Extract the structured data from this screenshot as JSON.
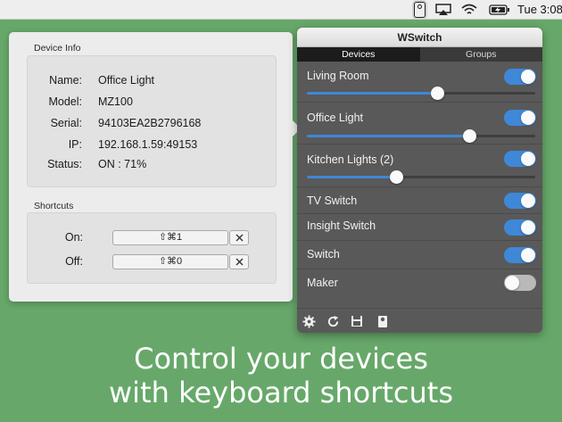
{
  "menubar": {
    "clock": "Tue 3:08",
    "icons": [
      "wswitch-app-icon",
      "airplay-icon",
      "wifi-icon",
      "battery-charging-icon"
    ]
  },
  "device_info": {
    "section_title": "Device Info",
    "fields": [
      {
        "label": "Name:",
        "value": "Office  Light"
      },
      {
        "label": "Model:",
        "value": "MZ100"
      },
      {
        "label": "Serial:",
        "value": "94103EA2B2796168"
      },
      {
        "label": "IP:",
        "value": "192.168.1.59:49153"
      },
      {
        "label": "Status:",
        "value": "ON : 71%"
      }
    ]
  },
  "shortcuts": {
    "section_title": "Shortcuts",
    "items": [
      {
        "label": "On:",
        "keys": "⇧⌘1"
      },
      {
        "label": "Off:",
        "keys": "⇧⌘0"
      }
    ]
  },
  "wswitch": {
    "title": "WSwitch",
    "tabs": [
      {
        "label": "Devices",
        "active": true
      },
      {
        "label": "Groups",
        "active": false
      }
    ],
    "devices": [
      {
        "name": "Living Room",
        "on": true,
        "dim_level": 0.57
      },
      {
        "name": "Office  Light",
        "on": true,
        "dim_level": 0.71
      },
      {
        "name": "Kitchen Lights (2)",
        "on": true,
        "dim_level": 0.39
      },
      {
        "name": "TV Switch",
        "on": true
      },
      {
        "name": "Insight  Switch",
        "on": true
      },
      {
        "name": "Switch",
        "on": true
      },
      {
        "name": "Maker",
        "on": false
      }
    ],
    "toolbar_icons": [
      "gear-icon",
      "refresh-icon",
      "save-icon",
      "device-icon"
    ]
  },
  "caption": {
    "line1": "Control your devices",
    "line2": "with keyboard shortcuts"
  },
  "colors": {
    "background": "#67a86a",
    "accent": "#3f88d8",
    "popover": "#595959"
  }
}
